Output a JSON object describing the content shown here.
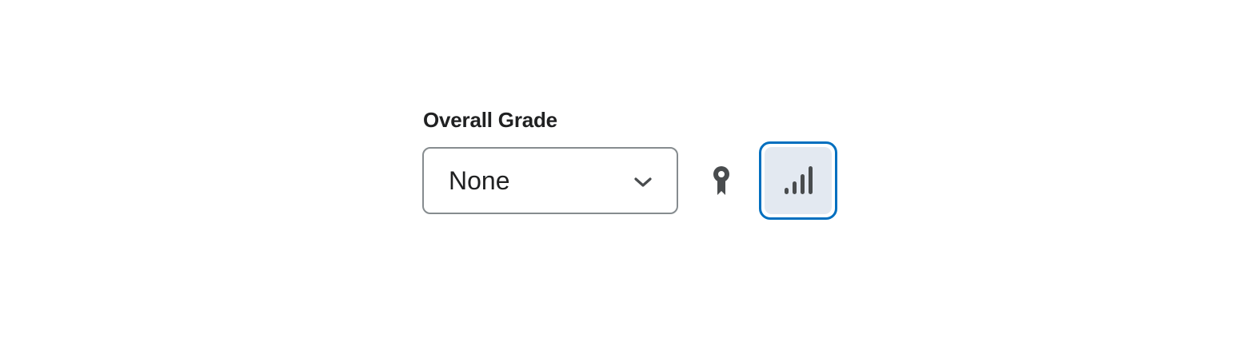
{
  "overall_grade": {
    "label": "Overall Grade",
    "select": {
      "value": "None",
      "icon": "chevron-down-icon"
    }
  },
  "icons": {
    "ribbon": "award-ribbon-icon",
    "stats": "bar-chart-icon"
  },
  "colors": {
    "focus_ring": "#006fbf",
    "button_bg": "#e3e9f1",
    "icon": "#494c4e",
    "text": "#202122",
    "select_border": "#868c8f"
  }
}
